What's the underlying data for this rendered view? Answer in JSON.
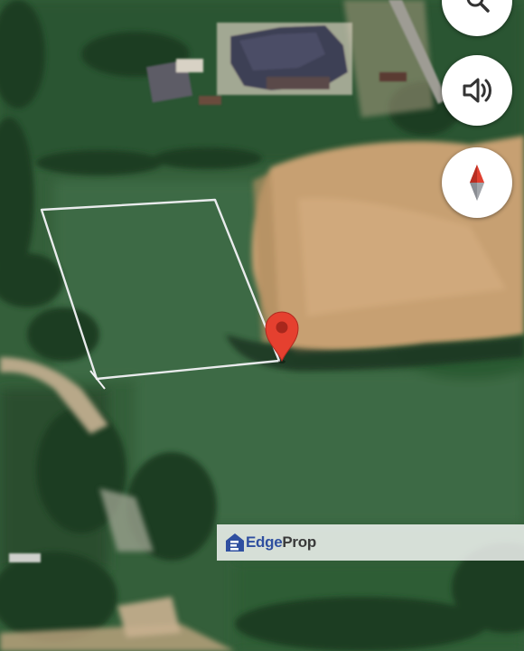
{
  "map": {
    "type": "satellite",
    "marker_color": "#e5402f",
    "plot_outline_color": "#f2f2f5"
  },
  "controls": {
    "search": {
      "icon": "search-icon"
    },
    "sound": {
      "icon": "speaker-icon"
    },
    "compass": {
      "icon": "compass-icon",
      "north_color": "#e04030"
    }
  },
  "watermark": {
    "brand_part_1": "Edge",
    "brand_part_2": "Prop",
    "brand_color": "#2f4fa0"
  }
}
